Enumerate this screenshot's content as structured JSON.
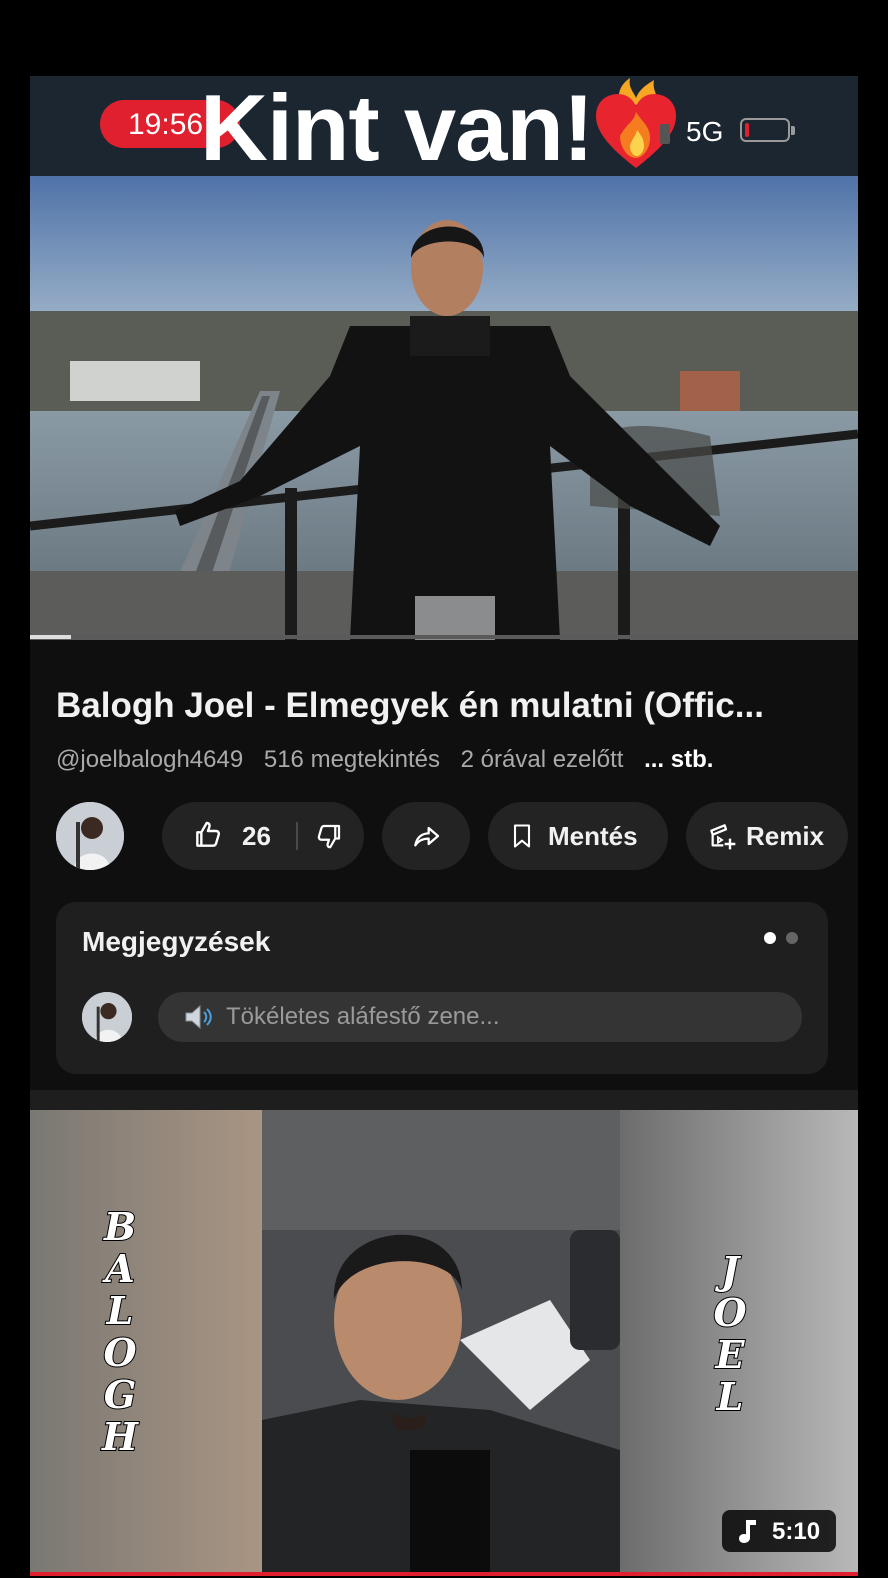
{
  "status_bar": {
    "time": "19:56",
    "overlay_text": "Kint van!",
    "overlay_emoji_icon": "heart-on-fire-icon",
    "network": "5G"
  },
  "video": {
    "title": "Balogh Joel - Elmegyek én mulatni (Offic...",
    "channel": "@joelbalogh4649",
    "views": "516 megtekintés",
    "age": "2 órával ezelőtt",
    "more": "... stb.",
    "progress_fraction": 0.05
  },
  "actions": {
    "like_count": "26",
    "save_label": "Mentés",
    "remix_label": "Remix"
  },
  "comments": {
    "title": "Megjegyzések",
    "placeholder": "Tökéletes aláfestő zene..."
  },
  "next_video": {
    "left_vertical_text": "BALOGH",
    "right_vertical_text": "JOEL",
    "duration": "5:10"
  },
  "colors": {
    "accent_red": "#e0202e",
    "background": "#0f0f0f",
    "pill": "#232323"
  }
}
